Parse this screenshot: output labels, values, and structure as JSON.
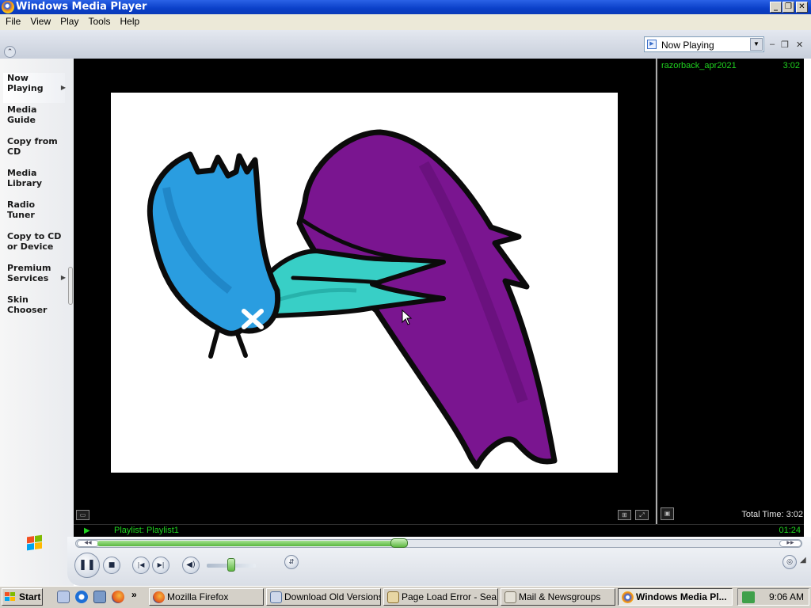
{
  "window": {
    "title": "Windows Media Player"
  },
  "window_buttons": {
    "minimize": "_",
    "restore": "❐",
    "close": "✕"
  },
  "menu": [
    "File",
    "View",
    "Play",
    "Tools",
    "Help"
  ],
  "now_playing_select": {
    "value": "Now Playing"
  },
  "sidebar": {
    "items": [
      {
        "label": "Now\nPlaying",
        "has_arrow": true,
        "active": true
      },
      {
        "label": "Media\nGuide"
      },
      {
        "label": "Copy from\nCD"
      },
      {
        "label": "Media\nLibrary"
      },
      {
        "label": "Radio\nTuner"
      },
      {
        "label": "Copy to CD\nor Device"
      },
      {
        "label": "Premium\nServices",
        "has_arrow": true
      },
      {
        "label": "Skin\nChooser"
      }
    ]
  },
  "playlist": {
    "tracks": [
      {
        "title": "razorback_apr2021",
        "duration": "3:02"
      }
    ],
    "total_time": "Total Time: 3:02"
  },
  "status": {
    "text": "Playlist: Playlist1",
    "elapsed": "01:24"
  },
  "playback": {
    "progress_fraction": 0.438,
    "volume_fraction": 0.5,
    "state": "playing"
  },
  "colors": {
    "status_text": "#1fd21f",
    "title_bar": "#0a3fc8",
    "accent_purple": "#7a1590",
    "accent_blue": "#2a9de0",
    "accent_teal": "#38cfc6"
  },
  "taskbar": {
    "start_label": "Start",
    "quicklaunch_icons": [
      "show-desktop-icon",
      "internet-explorer-icon",
      "network-icon",
      "firefox-icon"
    ],
    "quicklaunch_more": "»",
    "buttons": [
      {
        "label": "Mozilla Firefox",
        "icon": "firefox-icon"
      },
      {
        "label": "Download Old Versions...",
        "icon": "page-icon"
      },
      {
        "label": "Page Load Error - Sea...",
        "icon": "page-icon"
      },
      {
        "label": "Mail & Newsgroups",
        "icon": "mail-icon"
      },
      {
        "label": "Windows Media Pl...",
        "icon": "wmp-icon",
        "active": true
      }
    ],
    "clock": "9:06 AM"
  }
}
